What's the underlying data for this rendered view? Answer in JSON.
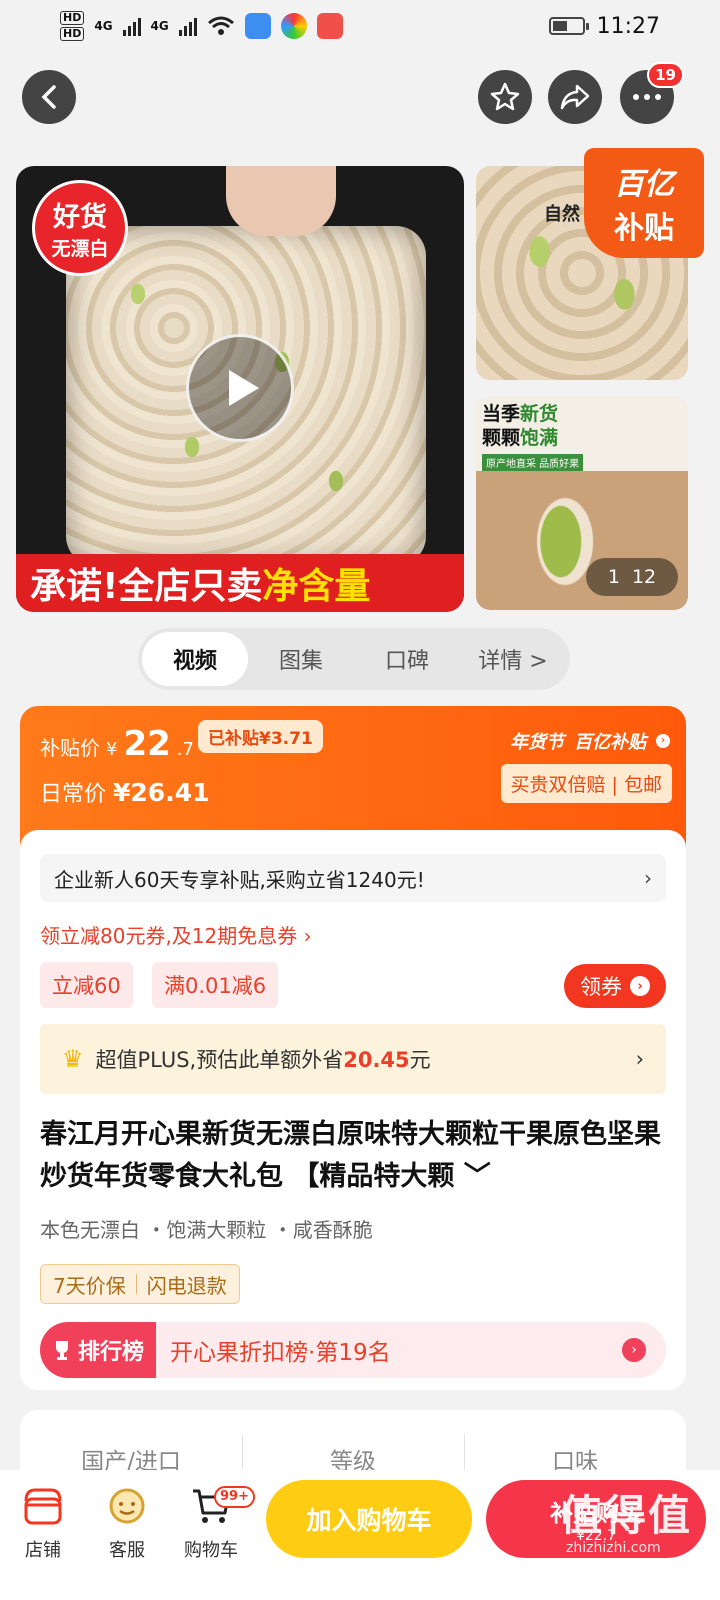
{
  "status_bar": {
    "time": "11:27",
    "net1": "4G",
    "net2": "4G",
    "hd1": "HD",
    "hd2": "HD"
  },
  "nav": {
    "notification_count": "19",
    "icons": [
      "back-icon",
      "star-icon",
      "share-icon",
      "more-icon"
    ]
  },
  "gallery": {
    "seal_line1": "好货",
    "seal_line2": "无漂白",
    "banner_white": "承诺!全店只卖",
    "banner_yellow": "净含量",
    "thumb1_tag": "自然",
    "thumb2_line1a": "当季",
    "thumb2_line1b": "新货",
    "thumb2_line2a": "颗颗",
    "thumb2_line2b": "饱满",
    "thumb2_small": "原产地直采 品质好果",
    "subsidy_line1": "百亿",
    "subsidy_line2": "补贴",
    "counter_current": "1",
    "counter_total": "12"
  },
  "media_tabs": [
    {
      "label": "视频",
      "active": true
    },
    {
      "label": "图集",
      "active": false
    },
    {
      "label": "口碑",
      "active": false
    },
    {
      "label": "详情 >",
      "active": false
    }
  ],
  "price": {
    "subsidy_label": "补贴价",
    "currency": "¥",
    "price_int": "22",
    "price_dec": ".7",
    "subsidized_chip": "已补贴¥3.71",
    "daily_label": "日常价",
    "daily_price": "¥26.41",
    "brand_1": "年货节",
    "brand_2": "百亿补贴",
    "guarantee": "买贵双倍赔 | 包邮"
  },
  "promo": {
    "newcomer_text": "企业新人60天专享补贴,采购立省1240元!",
    "coupon_text": "领立减80元券,及12期免息券 ›",
    "chip1": "立减60",
    "chip2": "满0.01减6",
    "get_coupon": "领券",
    "plus_text": "超值PLUS,预估此单额外省",
    "plus_amount": "20.45",
    "plus_unit": "元"
  },
  "product": {
    "title": "春江月开心果新货无漂白原味特大颗粒干果原色坚果炒货年货零食大礼包 【精品特大颗 ﹀",
    "tags": [
      "本色无漂白",
      "饱满大颗粒",
      "咸香酥脆"
    ],
    "service1": "7天价保",
    "service2": "闪电退款",
    "rank_head": "排行榜",
    "rank_text": "开心果折扣榜·第19名"
  },
  "attributes": [
    "国产/进口",
    "等级",
    "口味"
  ],
  "bottom_bar": {
    "shop": "店铺",
    "service": "客服",
    "cart": "购物车",
    "cart_badge": "99+",
    "add_to_cart": "加入购物车",
    "buy_line1": "补贴购买",
    "buy_line2": "¥22.7"
  },
  "watermark": {
    "main": "值得值",
    "sub": "zhizhizhi.com"
  },
  "colors": {
    "accent": "#ff5a0a",
    "red": "#f2361f",
    "yellow": "#ffcc14",
    "pink": "#f5364a"
  }
}
